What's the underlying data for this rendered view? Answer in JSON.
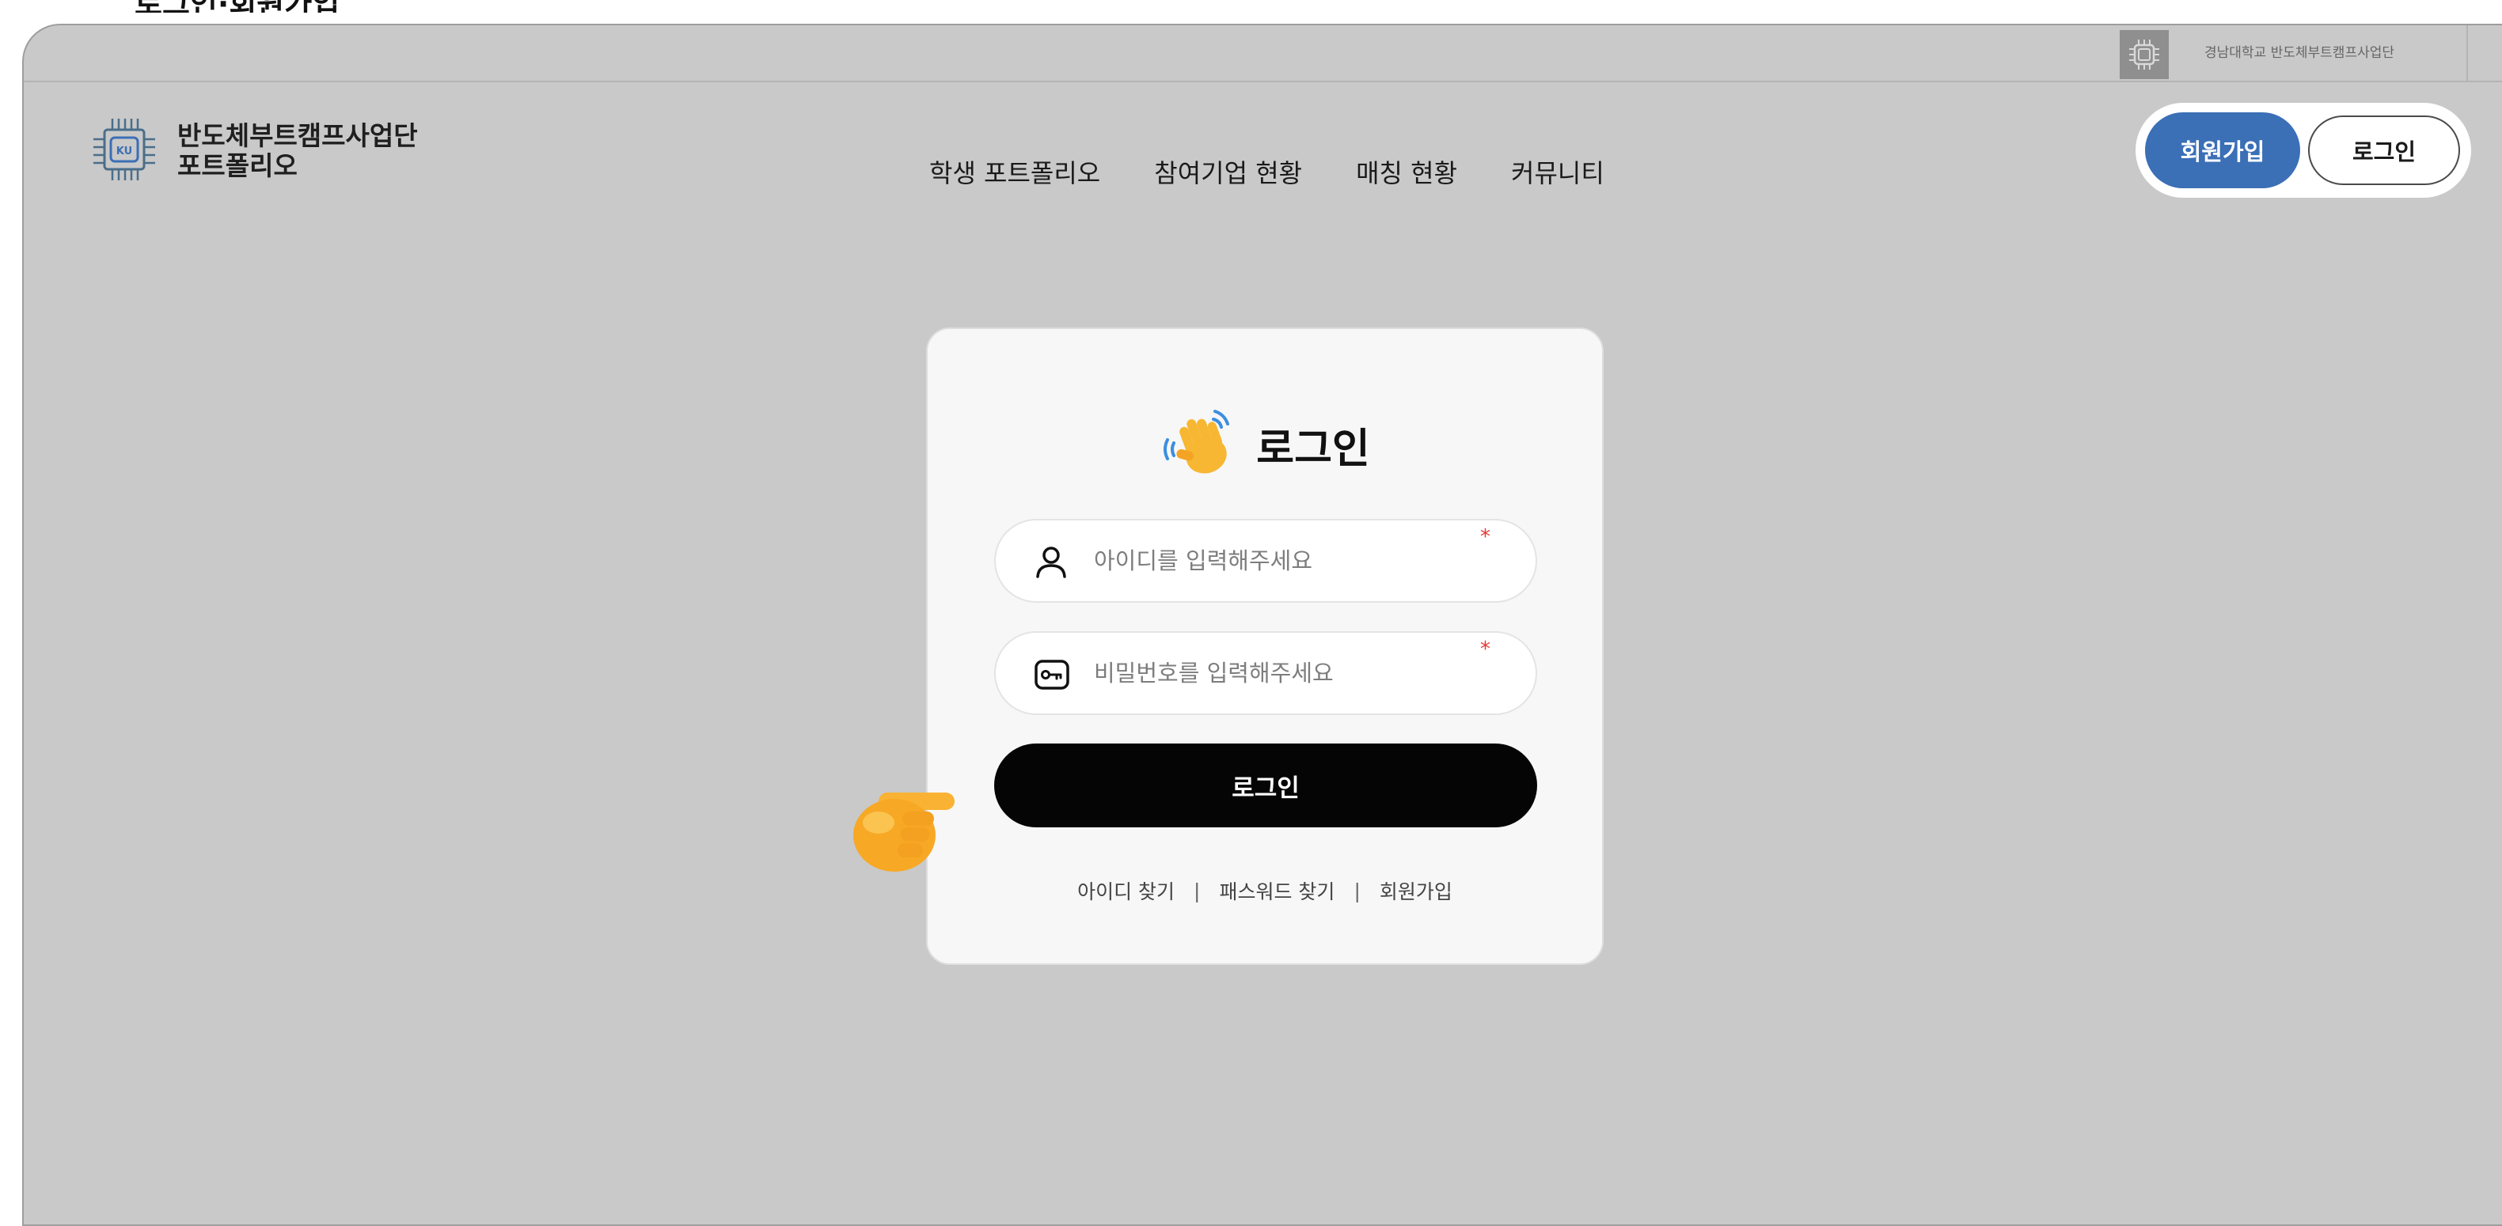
{
  "top_cropped_heading": "로그인·회원가입",
  "utility": {
    "org_text": "경남대학교 반도체부트캠프사업단"
  },
  "header": {
    "logo_badge": "KU",
    "logo_line1": "반도체부트캠프사업단",
    "logo_line2": "포트폴리오",
    "nav": [
      "학생 포트폴리오",
      "참여기업 현황",
      "매칭 현황",
      "커뮤니티"
    ],
    "signup_label": "회원가입",
    "login_label": "로그인"
  },
  "login_card": {
    "title": "로그인",
    "id_placeholder": "아이디를 입력해주세요",
    "pw_placeholder": "비밀번호를 입력해주세요",
    "required_mark": "*",
    "submit_label": "로그인",
    "links": [
      "아이디 찾기",
      "패스워드 찾기",
      "회원가입"
    ],
    "separator": "|"
  },
  "icons": {
    "utility": "chip-icon",
    "logo": "chip-logo-icon",
    "title": "waving-hand-icon",
    "id_field": "user-icon",
    "pw_field": "key-icon",
    "pointer": "pointing-hand-icon"
  },
  "colors": {
    "background": "#c9c9c9",
    "signup_button": "#3b6fb6",
    "login_button": "#050505",
    "card": "#f7f7f7",
    "required": "#e53935"
  }
}
